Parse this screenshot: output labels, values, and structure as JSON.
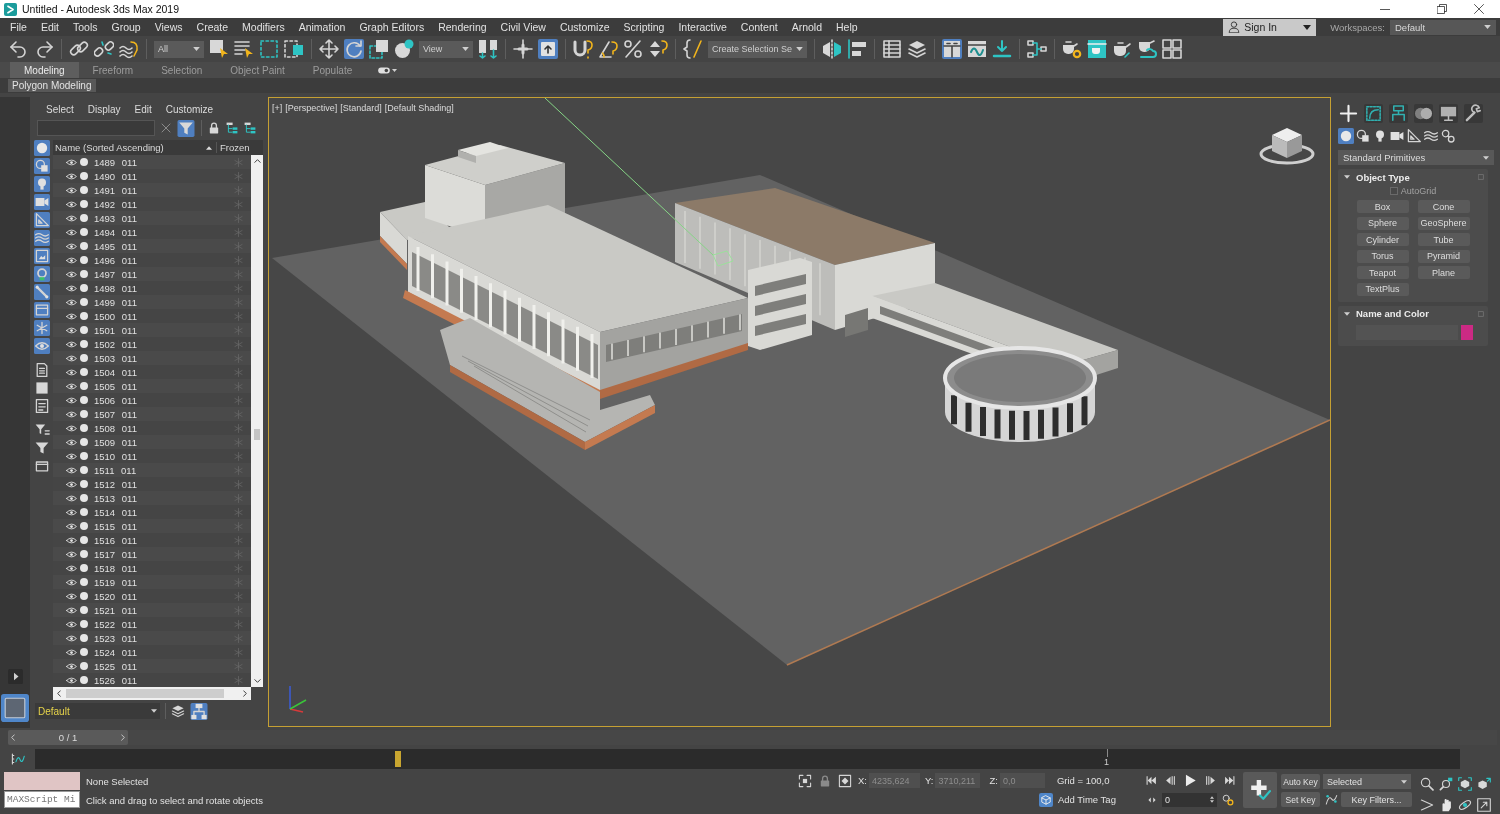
{
  "window": {
    "title": "Untitled - Autodesk 3ds Max 2019"
  },
  "menu_bar": {
    "items": [
      "File",
      "Edit",
      "Tools",
      "Group",
      "Views",
      "Create",
      "Modifiers",
      "Animation",
      "Graph Editors",
      "Rendering",
      "Civil View",
      "Customize",
      "Scripting",
      "Interactive",
      "Content",
      "Arnold",
      "Help"
    ],
    "sign_in": "Sign In",
    "workspaces_label": "Workspaces:",
    "workspace": "Default"
  },
  "main_toolbar": {
    "groups": [
      [
        {
          "kind": "button",
          "on": false
        },
        {
          "kind": "button",
          "on": false
        }
      ],
      [
        {
          "kind": "button",
          "on": false
        },
        {
          "kind": "button",
          "on": false
        },
        {
          "kind": "button",
          "on": false
        }
      ],
      [
        {
          "kind": "dropdown",
          "value": "All"
        },
        {
          "kind": "button",
          "on": false
        },
        {
          "kind": "button",
          "on": false
        },
        {
          "kind": "button",
          "on": false
        },
        {
          "kind": "button",
          "on": false
        }
      ],
      [
        {
          "kind": "button",
          "on": false
        },
        {
          "kind": "button",
          "on": true
        },
        {
          "kind": "button",
          "on": false
        },
        {
          "kind": "button",
          "on": false
        },
        {
          "kind": "dropdown",
          "value": "View"
        },
        {
          "kind": "button",
          "on": false
        }
      ],
      [
        {
          "kind": "button",
          "on": false
        },
        {
          "kind": "button",
          "on": true
        }
      ],
      [
        {
          "kind": "button",
          "on": false
        },
        {
          "kind": "button",
          "on": false
        },
        {
          "kind": "button",
          "on": false
        },
        {
          "kind": "button",
          "on": false
        }
      ],
      [
        {
          "kind": "button",
          "on": false
        },
        {
          "kind": "dropdown",
          "value": "Create Selection Se"
        }
      ],
      [
        {
          "kind": "button",
          "on": false
        },
        {
          "kind": "button",
          "on": false
        }
      ],
      [
        {
          "kind": "button",
          "on": false
        },
        {
          "kind": "button",
          "on": false
        }
      ],
      [
        {
          "kind": "button",
          "on": true
        },
        {
          "kind": "button",
          "on": false
        },
        {
          "kind": "button",
          "on": false
        }
      ],
      [
        {
          "kind": "button",
          "on": false
        }
      ],
      [
        {
          "kind": "button",
          "on": false
        },
        {
          "kind": "button",
          "on": false
        },
        {
          "kind": "button",
          "on": false
        },
        {
          "kind": "button",
          "on": false
        },
        {
          "kind": "button",
          "on": false
        }
      ]
    ]
  },
  "ribbon": {
    "tabs": [
      {
        "label": "Modeling",
        "selected": true
      },
      {
        "label": "Freeform",
        "selected": false
      },
      {
        "label": "Selection",
        "selected": false
      },
      {
        "label": "Object Paint",
        "selected": false
      },
      {
        "label": "Populate",
        "selected": false
      }
    ],
    "panel": "Polygon Modeling"
  },
  "scene_explorer": {
    "menu": [
      "Select",
      "Display",
      "Edit",
      "Customize"
    ],
    "tools": [
      {
        "on": true
      },
      {
        "on": false
      },
      {
        "on": false
      },
      {
        "on": false
      }
    ],
    "display_filters": [
      {
        "on": true
      },
      {
        "on": true
      },
      {
        "on": true
      },
      {
        "on": true
      },
      {
        "on": true
      },
      {
        "on": true
      },
      {
        "on": true
      },
      {
        "on": true
      },
      {
        "on": true
      },
      {
        "on": true
      },
      {
        "on": true
      },
      {
        "on": true
      },
      {
        "on": false
      },
      {
        "on": false
      },
      {
        "on": false
      },
      {
        "on": false
      },
      {
        "on": false
      },
      {
        "on": false
      }
    ],
    "columns": [
      "Name (Sorted Ascending)",
      "Frozen"
    ],
    "rows": [
      {
        "name": "1489 011",
        "frozen": false
      },
      {
        "name": "1490 011",
        "frozen": false
      },
      {
        "name": "1491 011",
        "frozen": false
      },
      {
        "name": "1492 011",
        "frozen": false
      },
      {
        "name": "1493 011",
        "frozen": false
      },
      {
        "name": "1494 011",
        "frozen": false
      },
      {
        "name": "1495 011",
        "frozen": false
      },
      {
        "name": "1496 011",
        "frozen": false
      },
      {
        "name": "1497 011",
        "frozen": false
      },
      {
        "name": "1498 011",
        "frozen": false
      },
      {
        "name": "1499 011",
        "frozen": false
      },
      {
        "name": "1500 011",
        "frozen": false
      },
      {
        "name": "1501 011",
        "frozen": false
      },
      {
        "name": "1502 011",
        "frozen": false
      },
      {
        "name": "1503 011",
        "frozen": false
      },
      {
        "name": "1504 011",
        "frozen": false
      },
      {
        "name": "1505 011",
        "frozen": false
      },
      {
        "name": "1506 011",
        "frozen": false
      },
      {
        "name": "1507 011",
        "frozen": false
      },
      {
        "name": "1508 011",
        "frozen": false
      },
      {
        "name": "1509 011",
        "frozen": false
      },
      {
        "name": "1510 011",
        "frozen": false
      },
      {
        "name": "1511 011",
        "frozen": false
      },
      {
        "name": "1512 011",
        "frozen": false
      },
      {
        "name": "1513 011",
        "frozen": false
      },
      {
        "name": "1514 011",
        "frozen": false
      },
      {
        "name": "1515 011",
        "frozen": false
      },
      {
        "name": "1516 011",
        "frozen": false
      },
      {
        "name": "1517 011",
        "frozen": false
      },
      {
        "name": "1518 011",
        "frozen": false
      },
      {
        "name": "1519 011",
        "frozen": false
      },
      {
        "name": "1520 011",
        "frozen": false
      },
      {
        "name": "1521 011",
        "frozen": false
      },
      {
        "name": "1522 011",
        "frozen": false
      },
      {
        "name": "1523 011",
        "frozen": false
      },
      {
        "name": "1524 011",
        "frozen": false
      },
      {
        "name": "1525 011",
        "frozen": false
      },
      {
        "name": "1526 011",
        "frozen": false
      }
    ],
    "layer": "Default",
    "layer_tools": [
      {
        "on": false
      },
      {
        "on": true
      }
    ]
  },
  "viewport": {
    "labels": [
      "[+]",
      "[Perspective]",
      "[Standard]",
      "[Default Shading]"
    ]
  },
  "command_panel": {
    "tabs": [
      {
        "selected": true
      },
      {
        "selected": false
      },
      {
        "selected": false
      },
      {
        "selected": false
      },
      {
        "selected": false
      },
      {
        "selected": false
      }
    ],
    "categories": [
      {
        "selected": true
      },
      {
        "selected": false
      },
      {
        "selected": false
      },
      {
        "selected": false
      },
      {
        "selected": false
      },
      {
        "selected": false
      },
      {
        "selected": false
      }
    ],
    "category_list": "Standard Primitives",
    "rollouts": [
      {
        "kind": "object_type",
        "title": "Object Type",
        "expanded": true,
        "autogrid": {
          "label": "AutoGrid",
          "checked": false,
          "disabled": true
        },
        "buttons": [
          "Box",
          "Cone",
          "Sphere",
          "GeoSphere",
          "Cylinder",
          "Tube",
          "Torus",
          "Pyramid",
          "Teapot",
          "Plane",
          "TextPlus"
        ]
      },
      {
        "kind": "name_color",
        "title": "Name and Color",
        "expanded": true,
        "color": "#cc2a84"
      }
    ]
  },
  "time_slider": {
    "label": "0 / 1",
    "level": 0
  },
  "track_bar": {
    "end_label": "1"
  },
  "status_bar": {
    "listener": "MAXScript Mi",
    "selection": "None Selected",
    "prompt": "Click and drag to select and rotate objects"
  },
  "coordinates": {
    "disabled": true,
    "fields": [
      {
        "label": "X:",
        "value": "4235,624"
      },
      {
        "label": "Y:",
        "value": "3710,211"
      },
      {
        "label": "Z:",
        "value": "0,0"
      }
    ],
    "grid": "Grid = 100,0",
    "time_tag": "Add Time Tag"
  },
  "playback": {
    "frame": "0"
  },
  "keying": {
    "auto_key": "Auto Key",
    "key_set": "Selected",
    "set_key": "Set Key",
    "key_filters": "Key Filters..."
  }
}
